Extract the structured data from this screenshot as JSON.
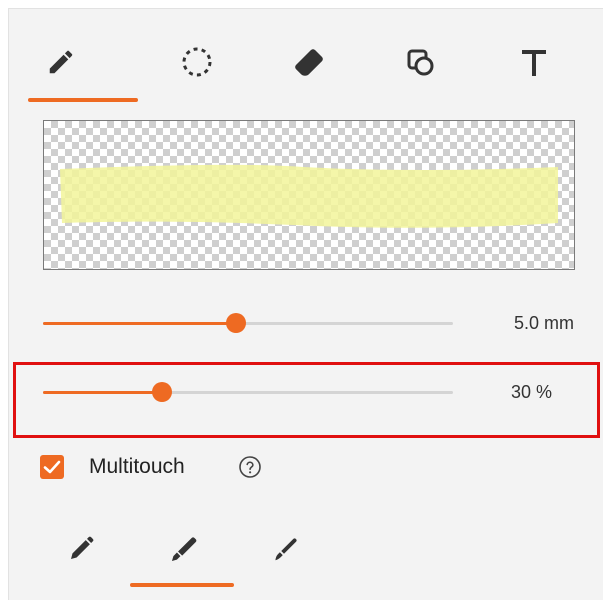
{
  "tools": [
    {
      "name": "pen",
      "icon": "pencil-icon",
      "selected": true
    },
    {
      "name": "lasso",
      "icon": "dotted-circle-icon",
      "selected": false
    },
    {
      "name": "eraser",
      "icon": "eraser-icon",
      "selected": false
    },
    {
      "name": "shapes",
      "icon": "shapes-icon",
      "selected": false
    },
    {
      "name": "text",
      "icon": "text-icon",
      "selected": false
    }
  ],
  "preview": {
    "stroke_color": "#f2f59a"
  },
  "size_slider": {
    "value_label": "5.0 mm",
    "fraction": 0.47
  },
  "opacity_slider": {
    "value_label": "30 %",
    "fraction": 0.29
  },
  "multitouch": {
    "label": "Multitouch",
    "checked": true
  },
  "pen_types": [
    {
      "name": "fountain-pen",
      "icon": "fountain-pen-icon",
      "selected": false
    },
    {
      "name": "highlighter",
      "icon": "highlighter-icon",
      "selected": true
    },
    {
      "name": "brush-pen",
      "icon": "brush-pen-icon",
      "selected": false
    }
  ],
  "colors": {
    "accent": "#ee6a22",
    "highlight_border": "#e01010",
    "icon": "#333333"
  }
}
